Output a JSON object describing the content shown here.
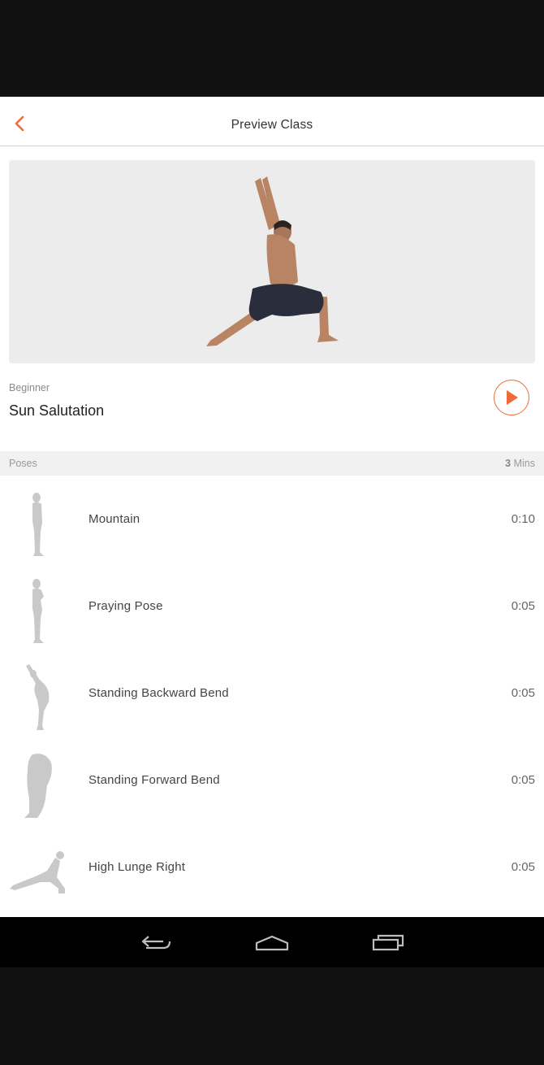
{
  "header": {
    "title": "Preview Class",
    "back_icon": "chevron-left-icon"
  },
  "accent_color": "#ef6a38",
  "class_info": {
    "level": "Beginner",
    "name": "Sun Salutation",
    "play_icon": "play-icon"
  },
  "poses_section": {
    "label": "Poses",
    "total_value": "3",
    "total_unit": "Mins"
  },
  "poses": [
    {
      "name": "Mountain",
      "duration": "0:10",
      "icon": "mountain-pose-icon"
    },
    {
      "name": "Praying Pose",
      "duration": "0:05",
      "icon": "praying-pose-icon"
    },
    {
      "name": "Standing Backward Bend",
      "duration": "0:05",
      "icon": "standing-backward-bend-icon"
    },
    {
      "name": "Standing Forward Bend",
      "duration": "0:05",
      "icon": "standing-forward-bend-icon"
    },
    {
      "name": "High Lunge Right",
      "duration": "0:05",
      "icon": "high-lunge-right-icon"
    }
  ],
  "system_nav": {
    "back": "back-icon",
    "home": "home-icon",
    "recents": "recents-icon"
  }
}
